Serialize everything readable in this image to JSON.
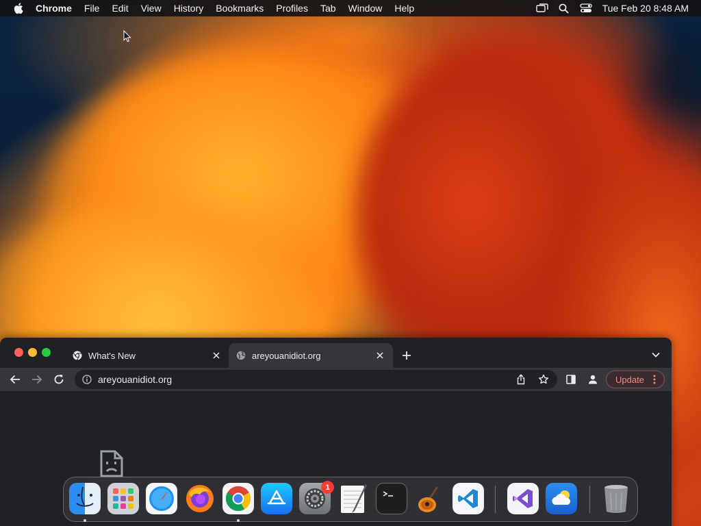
{
  "menubar": {
    "app_name": "Chrome",
    "items": [
      "File",
      "Edit",
      "View",
      "History",
      "Bookmarks",
      "Profiles",
      "Tab",
      "Window",
      "Help"
    ],
    "clock": "Tue Feb 20  8:48 AM"
  },
  "browser": {
    "tabs": [
      {
        "title": "What's New",
        "icon": "chrome-icon",
        "active": false
      },
      {
        "title": "areyouanidiot.org",
        "icon": "globe-icon",
        "active": true
      }
    ],
    "omnibox": {
      "url": "areyouanidiot.org"
    },
    "update_label": "Update"
  },
  "dock": {
    "apps": [
      "Finder",
      "Launchpad",
      "Safari",
      "Firefox",
      "Google Chrome",
      "App Store",
      "System Settings",
      "TextEdit",
      "Terminal",
      "GarageBand",
      "Visual Studio Code",
      "Visual Studio",
      "Weather",
      "Trash"
    ],
    "settings_badge": "1"
  },
  "colors": {
    "menubar": "#141416",
    "browser_bg": "#202124",
    "toolbar": "#35363a",
    "update_accent": "#f28b82"
  }
}
